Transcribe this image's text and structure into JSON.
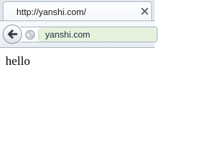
{
  "tab": {
    "title": "http://yanshi.com/"
  },
  "navigation": {
    "url": "yanshi.com"
  },
  "page": {
    "text": "hello"
  },
  "icons": {
    "tab_close": "close-icon",
    "back": "back-arrow-icon",
    "identity": "globe-icon"
  },
  "colors": {
    "url_field": "#e6f2dc"
  }
}
